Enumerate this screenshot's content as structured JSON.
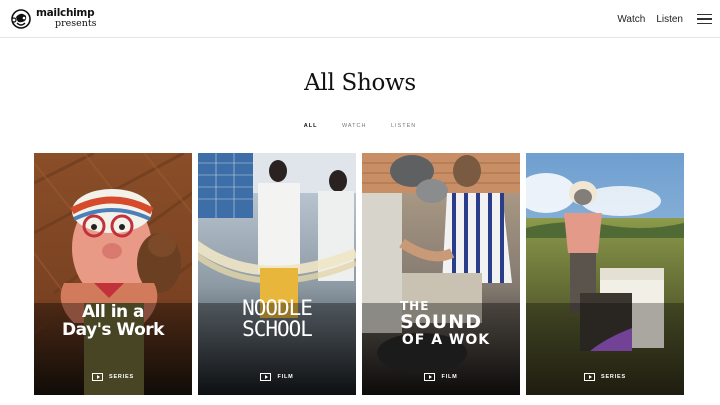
{
  "brand": {
    "name": "mailchimp",
    "sub": "presents"
  },
  "nav": {
    "watch": "Watch",
    "listen": "Listen"
  },
  "page": {
    "title": "All Shows"
  },
  "filters": [
    "ALL",
    "WATCH",
    "LISTEN"
  ],
  "cards": [
    {
      "title_line1": "All in a",
      "title_line2": "Day's Work",
      "type": "SERIES"
    },
    {
      "title_line1": "NOODLE",
      "title_line2": "SCHOOL",
      "type": "FILM"
    },
    {
      "title_line1": "THE",
      "title_line2": "SOUND",
      "title_line3": "OF A WOK",
      "type": "FILM"
    },
    {
      "title_line1": "",
      "type": "SERIES"
    }
  ]
}
